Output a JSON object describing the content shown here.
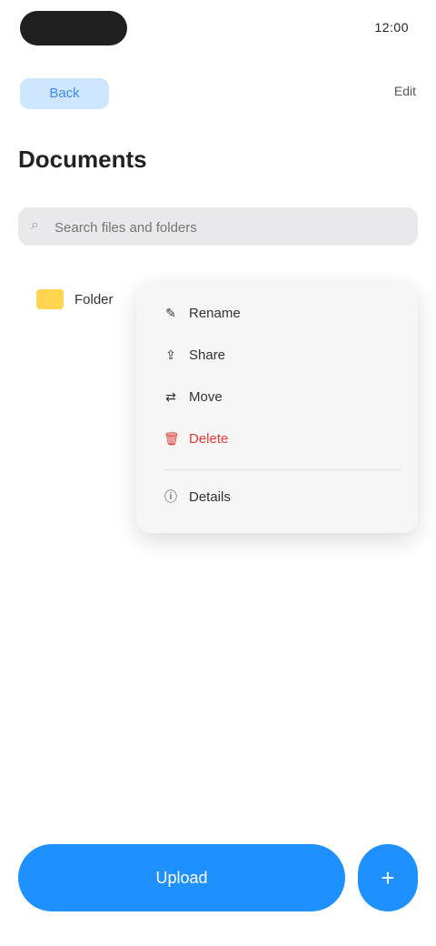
{
  "status": {
    "time": "12:00"
  },
  "nav": {
    "back_label": "Back",
    "right_label": "Edit"
  },
  "title": "Documents",
  "search": {
    "placeholder": "Search files and folders"
  },
  "row": {
    "label": "Folder"
  },
  "menu": {
    "items": [
      {
        "icon": "pencil-icon",
        "label": "Rename"
      },
      {
        "icon": "share-icon",
        "label": "Share"
      },
      {
        "icon": "move-icon",
        "label": "Move"
      },
      {
        "icon": "trash-icon",
        "label": "Delete",
        "danger": true
      },
      {
        "icon": "info-icon",
        "label": "Details"
      }
    ]
  },
  "actions": {
    "primary_label": "Upload",
    "fab_label": "+"
  },
  "colors": {
    "accent": "#1e90ff",
    "danger": "#e53935",
    "folder": "#ffd54f"
  }
}
